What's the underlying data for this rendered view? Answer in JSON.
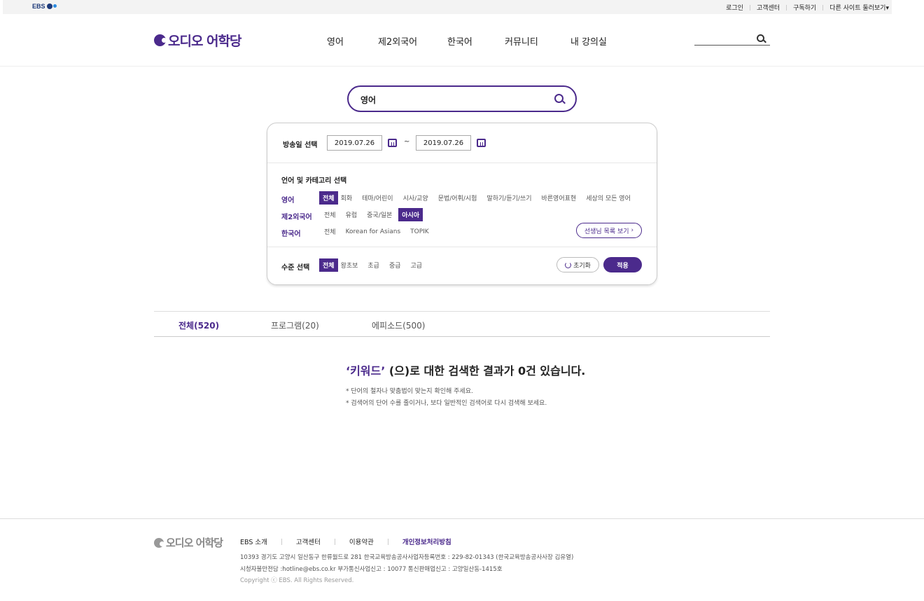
{
  "topbar": {
    "ebs_logo": "EBS",
    "links": [
      "로그인",
      "고객센터",
      "구독하기",
      "다른 사이트 둘러보기"
    ],
    "dropdown_glyph": "▾"
  },
  "header": {
    "brand": "오디오 어학당",
    "nav": [
      "영어",
      "제2외국어",
      "한국어",
      "커뮤니티",
      "내 강의실"
    ],
    "search_placeholder": ""
  },
  "search": {
    "value": "영어"
  },
  "filter": {
    "date_label": "방송일 선택",
    "date_from": "2019.07.26",
    "date_to": "2019.07.26",
    "date_sep": "~",
    "category_title": "언어 및 카테고리 선택",
    "categories": [
      {
        "name": "영어",
        "options": [
          "전체",
          "회화",
          "테마/어린이",
          "시사/교양",
          "문법/어휘/시험",
          "말하기/듣기/쓰기",
          "바른영어표현",
          "세상의 모든 영어"
        ],
        "selected": "전체"
      },
      {
        "name": "제2외국어",
        "options": [
          "전체",
          "유럽",
          "중국/일본",
          "아시아"
        ],
        "selected": "아시아"
      },
      {
        "name": "한국어",
        "options": [
          "전체",
          "Korean for Asians",
          "TOPIK"
        ],
        "selected": ""
      }
    ],
    "teacher_button": "선생님 목록 보기",
    "level_label": "수준 선택",
    "levels": [
      "전체",
      "왕초보",
      "초급",
      "중급",
      "고급"
    ],
    "level_selected": "전체",
    "reset_button": "초기화",
    "apply_button": "적용"
  },
  "tabs": [
    {
      "label": "전체(520)",
      "active": true
    },
    {
      "label": "프로그램(20)",
      "active": false
    },
    {
      "label": "에피소드(500)",
      "active": false
    }
  ],
  "result": {
    "keyword": "‘키워드’",
    "message": " (으)로 대한 검색한 결과가 0건 있습니다.",
    "notes": [
      "* 단어의 철자나 맞춤법이 맞는지 확인해 주세요.",
      "* 검색어의 단어 수를 줄이거나, 보다 일반적인 검색어로 다시 검색해 보세요."
    ]
  },
  "footer": {
    "brand": "오디오 어학당",
    "links": [
      "EBS 소개",
      "고객센터",
      "이용약관",
      "개인정보처리방침"
    ],
    "address": "10393 경기도 고양시 일산동구 한류월드로 281 한국교육방송공사사업자등록번호 : 229-82-01343 (한국교육방송공사사장 김유열)",
    "contact": "시청자불만전담 :hotline@ebs.co.kr 부가통신사업신고 : 10077 통신판매업신고 : 고양일산동-1415호",
    "copyright": "Copyright ⓒ EBS. All Rights Reserved."
  },
  "colors": {
    "accent": "#4b2a8c"
  }
}
